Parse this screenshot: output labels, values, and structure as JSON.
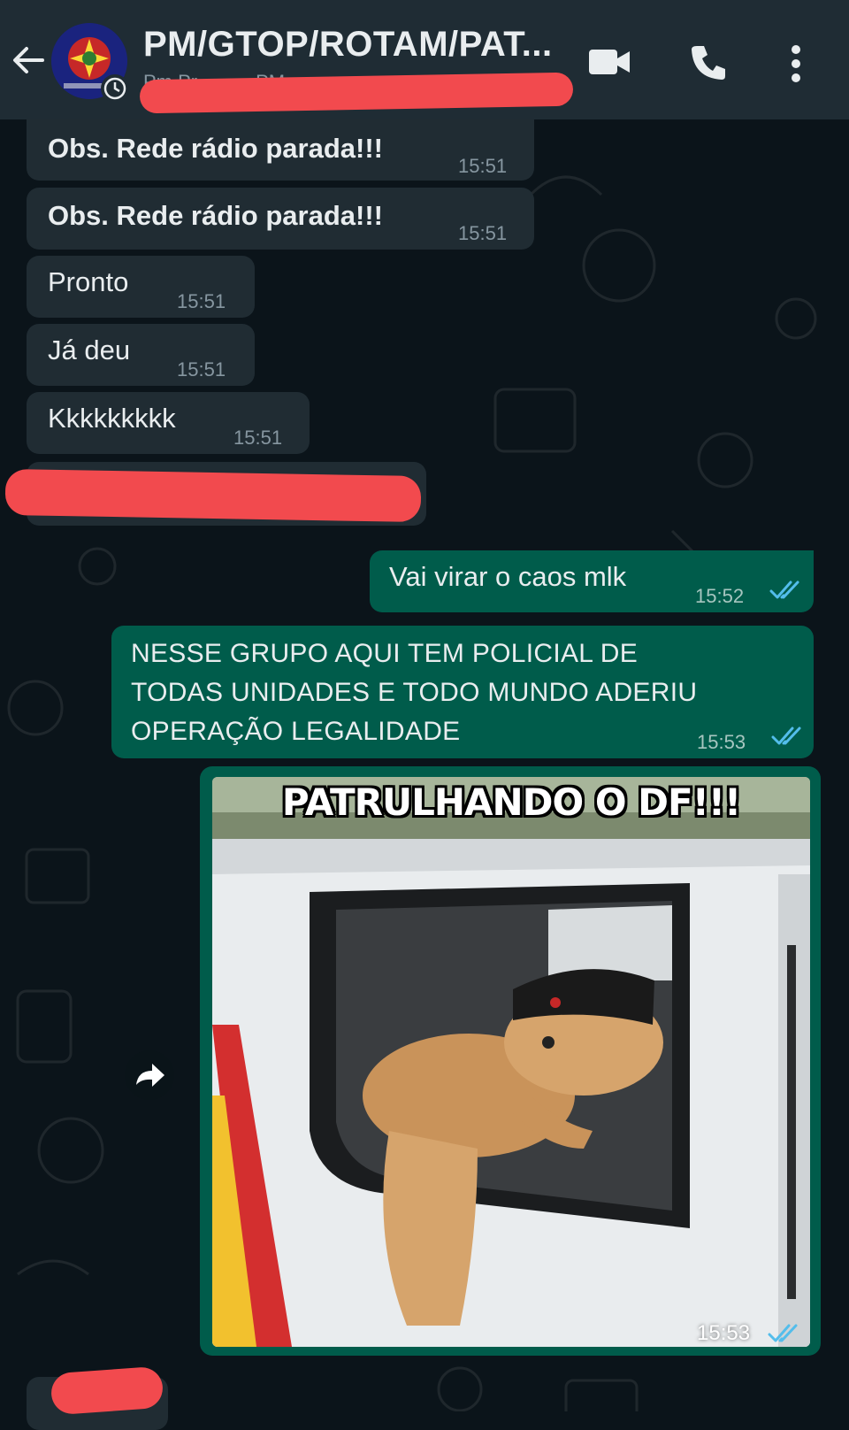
{
  "header": {
    "title": "PM/GTOP/ROTAM/PAT...",
    "subtitle": "Pm Pr...........PM...........o"
  },
  "messages": [
    {
      "text": "Obs. Rede rádio parada!!!",
      "time": "15:51"
    },
    {
      "text": "Obs. Rede rádio parada!!!",
      "time": "15:51"
    },
    {
      "text": "Pronto",
      "time": "15:51"
    },
    {
      "text": "Já deu",
      "time": "15:51"
    },
    {
      "text": "Kkkkkkkkk",
      "time": "15:51"
    },
    {
      "text": "Vai virar o caos mlk",
      "time": "15:52"
    },
    {
      "text_lines": [
        "NESSE GRUPO AQUI TEM POLICIAL DE",
        "TODAS UNIDADES E TODO MUNDO ADERIU",
        "OPERAÇÃO LEGALIDADE"
      ],
      "time": "15:53"
    }
  ],
  "image_message": {
    "caption": "PATRULHANDO O DF!!!",
    "time": "15:53"
  },
  "colors": {
    "background": "#0b141a",
    "header": "#1f2c34",
    "incoming_bubble": "#202c33",
    "outgoing_bubble": "#005c4b",
    "read_ticks": "#53bdeb",
    "redaction": "#f24a4e"
  },
  "icons": [
    "back-arrow-icon",
    "group-avatar",
    "video-call-icon",
    "phone-icon",
    "more-options-icon",
    "forward-icon",
    "double-check-icon"
  ]
}
